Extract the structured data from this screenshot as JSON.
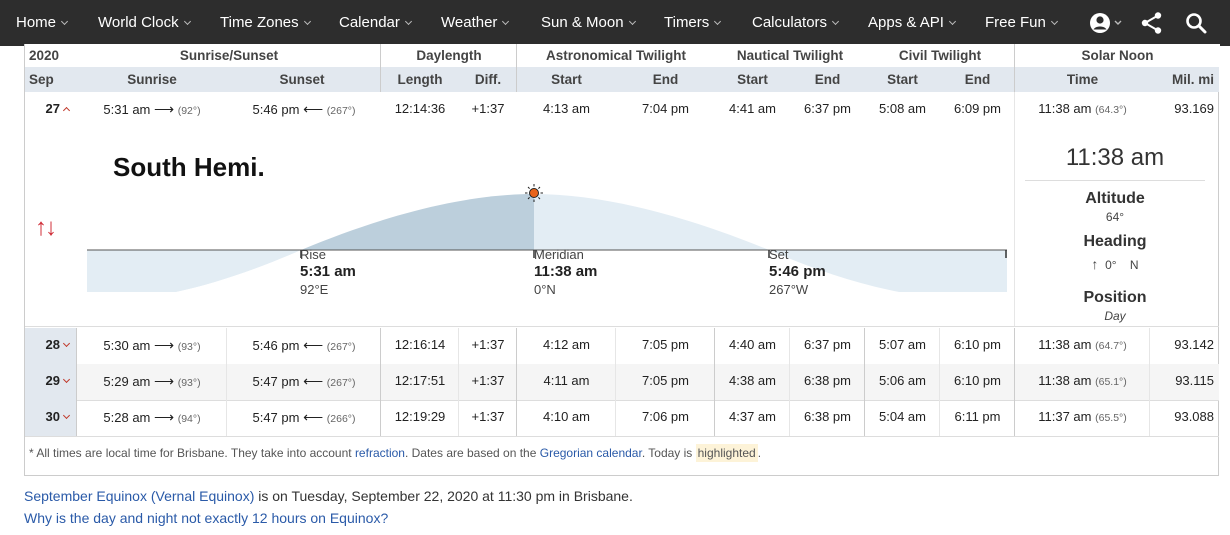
{
  "nav": {
    "items": [
      "Home",
      "World Clock",
      "Time Zones",
      "Calendar",
      "Weather",
      "Sun & Moon",
      "Timers",
      "Calculators",
      "Apps & API",
      "Free Fun"
    ]
  },
  "table": {
    "header1": {
      "year": "2020",
      "sunrise_sunset": "Sunrise/Sunset",
      "daylength": "Daylength",
      "astro": "Astronomical Twilight",
      "nautical": "Nautical Twilight",
      "civil": "Civil Twilight",
      "solar_noon": "Solar Noon"
    },
    "header2": {
      "month": "Sep",
      "sunrise": "Sunrise",
      "sunset": "Sunset",
      "length": "Length",
      "diff": "Diff.",
      "astro_start": "Start",
      "astro_end": "End",
      "naut_start": "Start",
      "naut_end": "End",
      "civil_start": "Start",
      "civil_end": "End",
      "time": "Time",
      "mil_mi": "Mil. mi"
    },
    "rows": [
      {
        "day": "27",
        "sunrise": "5:31 am",
        "sunrise_az": "(92°)",
        "sunset": "5:46 pm",
        "sunset_az": "(267°)",
        "length": "12:14:36",
        "diff": "+1:37",
        "astro_start": "4:13 am",
        "astro_end": "7:04 pm",
        "naut_start": "4:41 am",
        "naut_end": "6:37 pm",
        "civil_start": "5:08 am",
        "civil_end": "6:09 pm",
        "noon": "11:38 am",
        "noon_alt": "(64.3°)",
        "distance": "93.169"
      },
      {
        "day": "28",
        "sunrise": "5:30 am",
        "sunrise_az": "(93°)",
        "sunset": "5:46 pm",
        "sunset_az": "(267°)",
        "length": "12:16:14",
        "diff": "+1:37",
        "astro_start": "4:12 am",
        "astro_end": "7:05 pm",
        "naut_start": "4:40 am",
        "naut_end": "6:37 pm",
        "civil_start": "5:07 am",
        "civil_end": "6:10 pm",
        "noon": "11:38 am",
        "noon_alt": "(64.7°)",
        "distance": "93.142"
      },
      {
        "day": "29",
        "sunrise": "5:29 am",
        "sunrise_az": "(93°)",
        "sunset": "5:47 pm",
        "sunset_az": "(267°)",
        "length": "12:17:51",
        "diff": "+1:37",
        "astro_start": "4:11 am",
        "astro_end": "7:05 pm",
        "naut_start": "4:38 am",
        "naut_end": "6:38 pm",
        "civil_start": "5:06 am",
        "civil_end": "6:10 pm",
        "noon": "11:38 am",
        "noon_alt": "(65.1°)",
        "distance": "93.115"
      },
      {
        "day": "30",
        "sunrise": "5:28 am",
        "sunrise_az": "(94°)",
        "sunset": "5:47 pm",
        "sunset_az": "(266°)",
        "length": "12:19:29",
        "diff": "+1:37",
        "astro_start": "4:10 am",
        "astro_end": "7:06 pm",
        "naut_start": "4:37 am",
        "naut_end": "6:38 pm",
        "civil_start": "5:04 am",
        "civil_end": "6:11 pm",
        "noon": "11:37 am",
        "noon_alt": "(65.5°)",
        "distance": "93.088"
      }
    ]
  },
  "detail": {
    "hemisphere": "South Hemi.",
    "rise": {
      "label": "Rise",
      "time": "5:31 am",
      "dir": "92°E"
    },
    "meridian": {
      "label": "Meridian",
      "time": "11:38 am",
      "dir": "0°N"
    },
    "set": {
      "label": "Set",
      "time": "5:46 pm",
      "dir": "267°W"
    },
    "side": {
      "time": "11:38 am",
      "altitude_label": "Altitude",
      "altitude": "64°",
      "heading_label": "Heading",
      "heading_value": "0°",
      "heading_dir": "N",
      "position_label": "Position",
      "position": "Day"
    }
  },
  "note": {
    "prefix": "* All times are local time for Brisbane. They take into account ",
    "refraction": "refraction",
    "mid": ". Dates are based on the ",
    "gregorian": "Gregorian calendar",
    "mid2": ". Today is ",
    "highlighted": "highlighted",
    "end": "."
  },
  "footer": {
    "equinox_link": "September Equinox (Vernal Equinox)",
    "equinox_text": " is on Tuesday, September 22, 2020 at 11:30 pm in Brisbane.",
    "question": "Why is the day and night not exactly 12 hours on Equinox?"
  }
}
